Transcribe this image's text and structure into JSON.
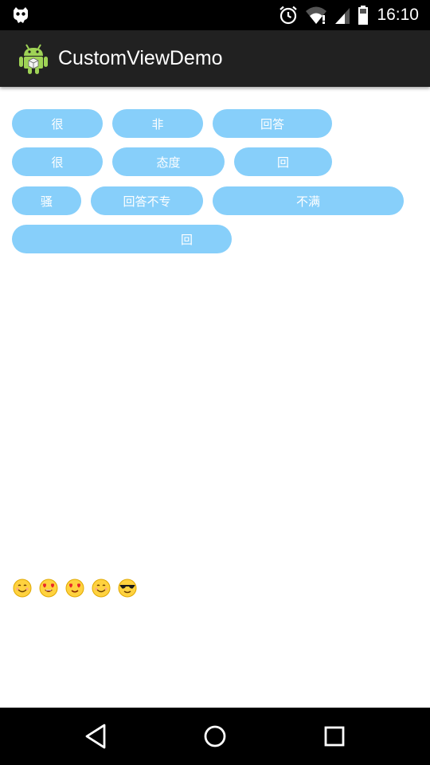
{
  "status_bar": {
    "time": "16:10",
    "icons": [
      "debug-icon",
      "alarm-icon",
      "wifi-icon",
      "signal-icon",
      "battery-icon"
    ]
  },
  "action_bar": {
    "title": "CustomViewDemo",
    "icon": "android-app-icon"
  },
  "tags": {
    "color": "#87cffa",
    "text_color": "#ffffff",
    "items": [
      "很",
      "非",
      "回答",
      "很",
      "态度",
      "回",
      "骚",
      "回答不专",
      "不满",
      "回"
    ]
  },
  "emojis": [
    "smile-emoji",
    "heart-eyes-emoji",
    "heart-eyes-emoji",
    "smile-emoji",
    "sunglasses-emoji"
  ],
  "nav_bar": {
    "buttons": [
      "back-icon",
      "home-icon",
      "recents-icon"
    ]
  }
}
